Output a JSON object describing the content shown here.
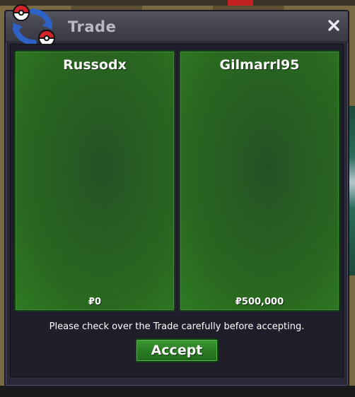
{
  "window": {
    "title": "Trade",
    "close_glyph": "✕",
    "icon": "pokeball-swap-icon"
  },
  "offers": [
    {
      "player": "Russodx",
      "money": "₽0"
    },
    {
      "player": "Gilmarrl95",
      "money": "₽500,000"
    }
  ],
  "notice": "Please check over the Trade carefully before accepting.",
  "accept_label": "Accept",
  "colors": {
    "panel_green": "#2a6a20",
    "button_green": "#2a7a22",
    "window_bg": "#2a2838",
    "title_text": "#b9b9c4"
  }
}
